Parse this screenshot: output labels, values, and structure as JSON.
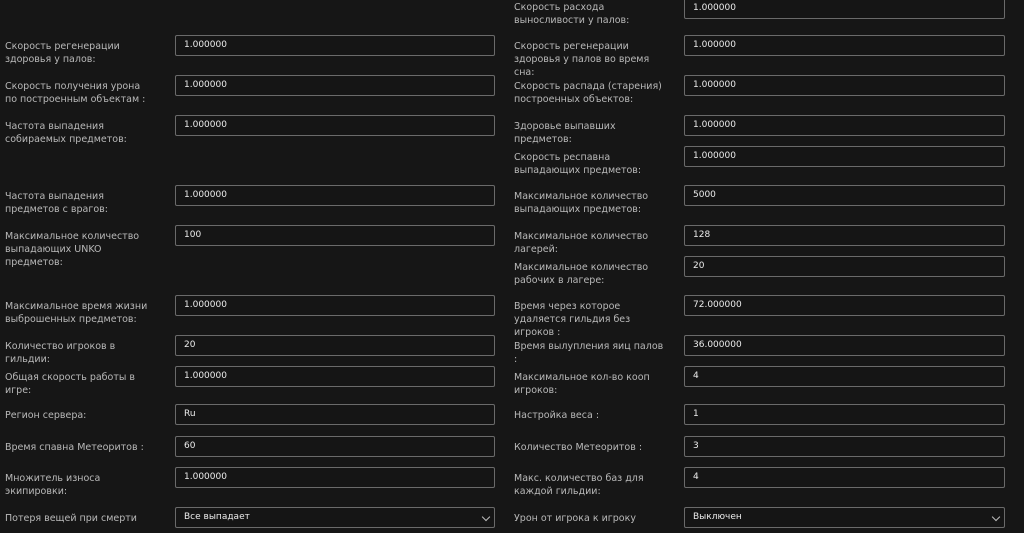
{
  "left": [
    {
      "label": "Скорость регенерации здоровья у палов:",
      "value": "1.000000"
    },
    {
      "label": "Скорость получения урона по построенным объектам :",
      "value": "1.000000"
    },
    {
      "label": "Частота выпадения собираемых предметов:",
      "value": "1.000000"
    },
    {
      "label": "Частота выпадения предметов с врагов:",
      "value": "1.000000"
    },
    {
      "label": "Максимальное количество выпадающих UNKO предметов:",
      "value": "100"
    },
    {
      "label": "Максимальное время жизни выброшенных предметов:",
      "value": "1.000000"
    },
    {
      "label": "Количество игроков в гильдии:",
      "value": "20"
    },
    {
      "label": "Общая скорость работы в игре:",
      "value": "1.000000"
    },
    {
      "label": "Регион сервера:",
      "value": "Ru"
    },
    {
      "label": "Время спавна Метеоритов :",
      "value": "60"
    },
    {
      "label": "Множитель износа экипировки:",
      "value": "1.000000"
    },
    {
      "label": "Потеря вещей при смерти",
      "value": "Все выпадает"
    }
  ],
  "right": [
    {
      "label": "Скорость расхода выносливости у палов:",
      "value": "1.000000"
    },
    {
      "label": "Скорость регенерации здоровья у палов во время сна:",
      "value": "1.000000"
    },
    {
      "label": "Скорость распада (старения) построенных объектов:",
      "value": "1.000000"
    },
    {
      "label": "Здоровье выпавших предметов:",
      "value": "1.000000"
    },
    {
      "label": "Скорость респавна выпадающих предметов:",
      "value": "1.000000"
    },
    {
      "label": "Максимальное количество выпадающих предметов:",
      "value": "5000"
    },
    {
      "label": "Максимальное количество лагерей:",
      "value": "128"
    },
    {
      "label": "Максимальное количество рабочих в лагере:",
      "value": "20"
    },
    {
      "label": "Время через которое удаляется гильдия без игроков :",
      "value": "72.000000"
    },
    {
      "label": "Время вылупления яиц палов :",
      "value": "36.000000"
    },
    {
      "label": "Максимальное кол-во кооп игроков:",
      "value": "4"
    },
    {
      "label": "Настройка веса :",
      "value": "1"
    },
    {
      "label": "Количество Метеоритов :",
      "value": "3"
    },
    {
      "label": "Макс. количество баз для каждой гильдии:",
      "value": "4"
    },
    {
      "label": "Урон от игрока к игроку",
      "value": "Выключен"
    }
  ]
}
